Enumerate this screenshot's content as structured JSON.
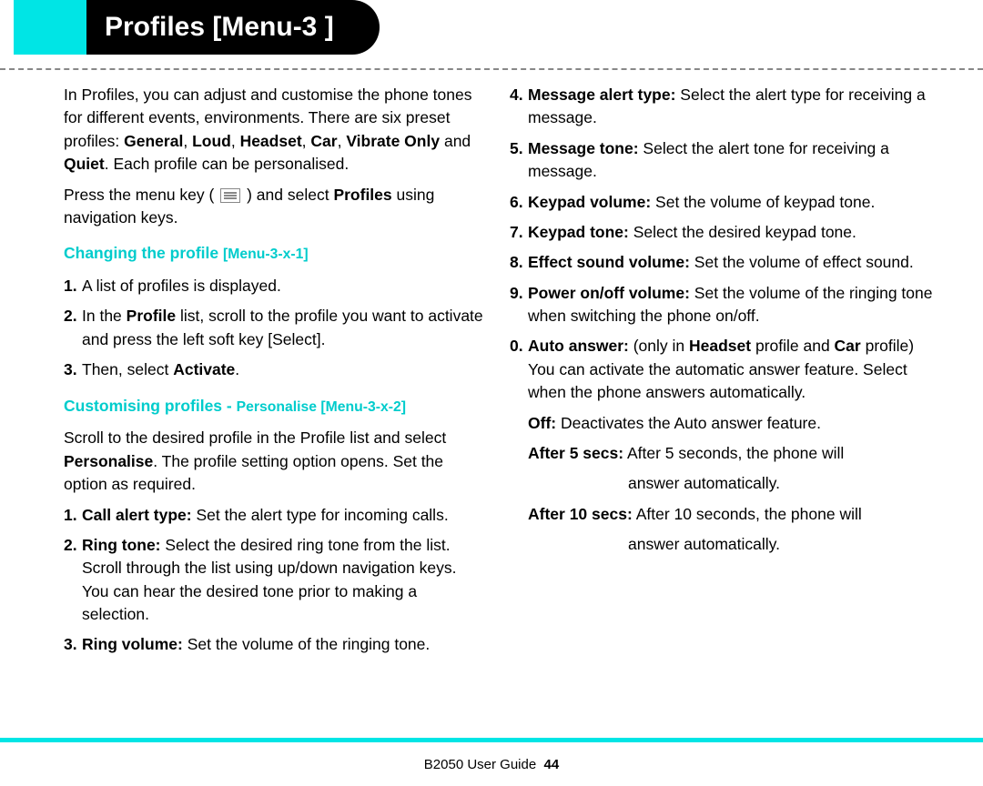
{
  "title": "Profiles [Menu-3 ]",
  "intro": {
    "p1a": "In Profiles, you can adjust and customise the phone tones for different events, environments. There are six preset profiles: ",
    "p1b_general": "General",
    "p1b_loud": "Loud",
    "p1b_headset": "Headset",
    "p1b_car": "Car",
    "p1b_vibrate": "Vibrate Only",
    "p1b_quiet": "Quiet",
    "p1c": ". Each profile can be personalised.",
    "p2a": "Press the menu key (",
    "p2b": ") and select ",
    "p2c_profiles": "Profiles",
    "p2d": " using navigation keys."
  },
  "section1": {
    "heading_main": "Changing the profile ",
    "heading_code": "[Menu-3-x-1]",
    "items": {
      "i1": "A list of profiles is displayed.",
      "i2a": "In the ",
      "i2b_profile": "Profile",
      "i2c": " list, scroll to the profile you want to activate and press the left soft key [Select].",
      "i3a": "Then, select ",
      "i3b_activate": "Activate",
      "i3c": "."
    }
  },
  "section2": {
    "heading_main": "Customising profiles - ",
    "heading_sub": "Personalise ",
    "heading_code": "[Menu-3-x-2]",
    "intro_a": "Scroll to the desired profile in the Profile list and select ",
    "intro_b_personalise": "Personalise",
    "intro_c": ". The profile setting option opens. Set the option as required.",
    "items": {
      "i1_label": "Call alert type:",
      "i1_text": " Set the alert type for incoming calls.",
      "i2_label": "Ring tone:",
      "i2_text": " Select the desired ring tone from the list. Scroll through the list using up/down navigation keys. You can hear the desired tone prior to making a selection.",
      "i3_label": "Ring volume:",
      "i3_text": " Set the volume of the ringing tone.",
      "i4_label": "Message alert type:",
      "i4_text": " Select the alert type for receiving a message.",
      "i5_label": "Message tone:",
      "i5_text": " Select the alert tone for receiving a message.",
      "i6_label": "Keypad volume:",
      "i6_text": " Set the volume of keypad tone.",
      "i7_label": "Keypad tone:",
      "i7_text": " Select the desired keypad tone.",
      "i8_label": "Effect sound volume:",
      "i8_text": " Set the volume of effect sound.",
      "i9_label": "Power on/off volume:",
      "i9_text": " Set the volume of the ringing tone when switching the phone on/off.",
      "i0_label": "Auto answer:",
      "i0_text_a": " (only in ",
      "i0_text_b_headset": "Headset",
      "i0_text_c": " profile and ",
      "i0_text_d_car": "Car",
      "i0_text_e": " profile) You can activate the automatic answer feature. Select when the phone answers automatically.",
      "off_label": "Off:",
      "off_text": " Deactivates the Auto answer feature.",
      "a5_label": "After 5 secs:",
      "a5_text": " After 5 seconds, the phone will",
      "a5_text2": "answer automatically.",
      "a10_label": "After 10 secs:",
      "a10_text": " After 10 seconds, the phone will",
      "a10_text2": "answer automatically."
    }
  },
  "footer": {
    "guide": "B2050 User Guide",
    "page": "44"
  },
  "sep_comma": ", ",
  "sep_and": " and "
}
